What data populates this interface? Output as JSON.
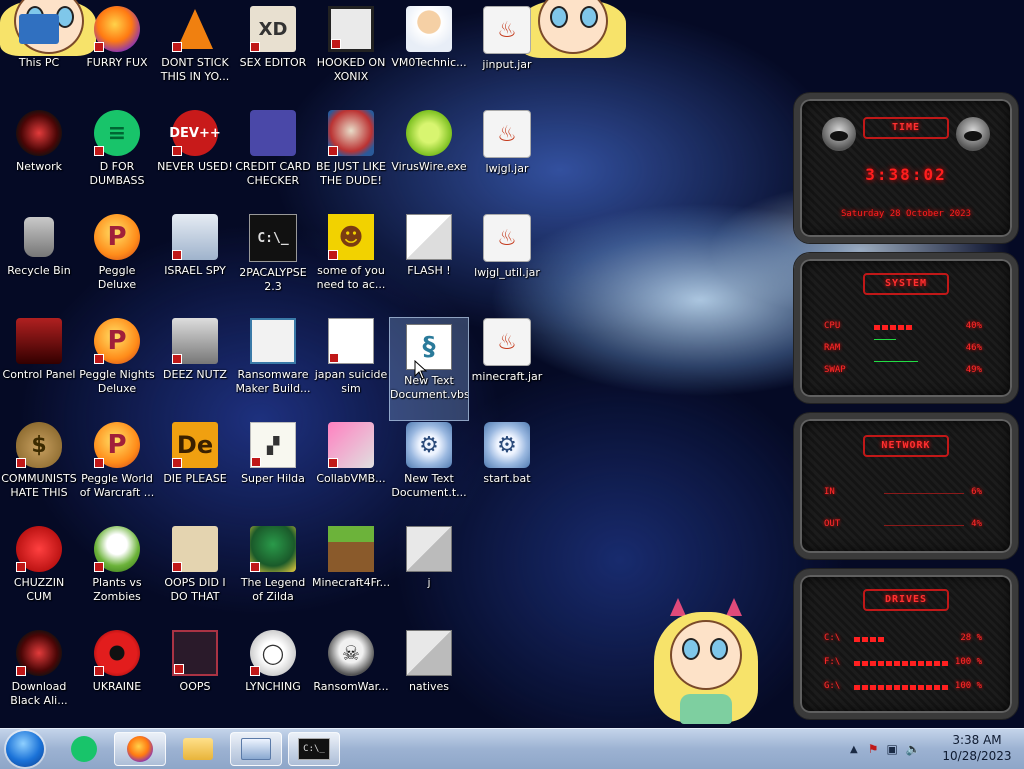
{
  "desktop": {
    "icons": [
      {
        "label": "This PC"
      },
      {
        "label": "FURRY FUX"
      },
      {
        "label": "DONT STICK THIS IN YO..."
      },
      {
        "label": "SEX EDITOR"
      },
      {
        "label": "HOOKED ON XONIX"
      },
      {
        "label": "VM0Technic..."
      },
      {
        "label": "jinput.jar"
      },
      {
        "label": "Network"
      },
      {
        "label": "D FOR DUMBASS"
      },
      {
        "label": "NEVER USED!"
      },
      {
        "label": "CREDIT CARD CHECKER"
      },
      {
        "label": "BE JUST LIKE THE DUDE!"
      },
      {
        "label": "VirusWire.exe"
      },
      {
        "label": "lwjgl.jar"
      },
      {
        "label": "Recycle Bin"
      },
      {
        "label": "Peggle Deluxe"
      },
      {
        "label": "ISRAEL SPY"
      },
      {
        "label": "2PACALYPSE 2.3"
      },
      {
        "label": "some of you need to ac..."
      },
      {
        "label": "FLASH !"
      },
      {
        "label": "lwjgl_util.jar"
      },
      {
        "label": "Control Panel"
      },
      {
        "label": "Peggle Nights Deluxe"
      },
      {
        "label": "DEEZ NUTZ"
      },
      {
        "label": "Ransomware Maker Build..."
      },
      {
        "label": "japan suicide sim"
      },
      {
        "label": "New Text Document.vbs"
      },
      {
        "label": "minecraft.jar"
      },
      {
        "label": "COMMUNISTS HATE THIS G..."
      },
      {
        "label": "Peggle World of Warcraft ..."
      },
      {
        "label": "DIE PLEASE"
      },
      {
        "label": "Super Hilda"
      },
      {
        "label": "CollabVMB..."
      },
      {
        "label": "New Text Document.t..."
      },
      {
        "label": "start.bat"
      },
      {
        "label": "CHUZZIN CUM"
      },
      {
        "label": "Plants vs Zombies"
      },
      {
        "label": "OOPS DID I DO THAT"
      },
      {
        "label": "The Legend of Zilda"
      },
      {
        "label": "Minecraft4Fr..."
      },
      {
        "label": "j"
      },
      {
        "label": "Download Black Ali..."
      },
      {
        "label": "UKRAINE"
      },
      {
        "label": "OOPS"
      },
      {
        "label": "LYNCHING"
      },
      {
        "label": "RansomWar..."
      },
      {
        "label": "natives"
      }
    ],
    "glyphs": {
      "xd": "XD",
      "dev": "DEV++",
      "cmd": "C:\\_",
      "die": "De",
      "money": "$",
      "peg": "P",
      "jar": "♨"
    }
  },
  "widget": {
    "time": {
      "title": "TIME",
      "clock": "3:38:02",
      "date": "Saturday 28 October 2023"
    },
    "system": {
      "title": "SYSTEM",
      "rows": [
        {
          "label": "CPU",
          "value": "40%",
          "pct": 40
        },
        {
          "label": "RAM",
          "value": "46%",
          "pct": 46
        },
        {
          "label": "SWAP",
          "value": "49%",
          "pct": 49
        }
      ]
    },
    "network": {
      "title": "NETWORK",
      "rows": [
        {
          "label": "IN",
          "value": "6%"
        },
        {
          "label": "OUT",
          "value": "4%"
        }
      ]
    },
    "drives": {
      "title": "DRIVES",
      "rows": [
        {
          "label": "C:\\",
          "value": "28 %",
          "pct": 28
        },
        {
          "label": "F:\\",
          "value": "100 %",
          "pct": 100
        },
        {
          "label": "G:\\",
          "value": "100 %",
          "pct": 100
        }
      ]
    }
  },
  "taskbar": {
    "clock_time": "3:38 AM",
    "clock_date": "10/28/2023",
    "cmd_glyph": "C:\\_"
  }
}
